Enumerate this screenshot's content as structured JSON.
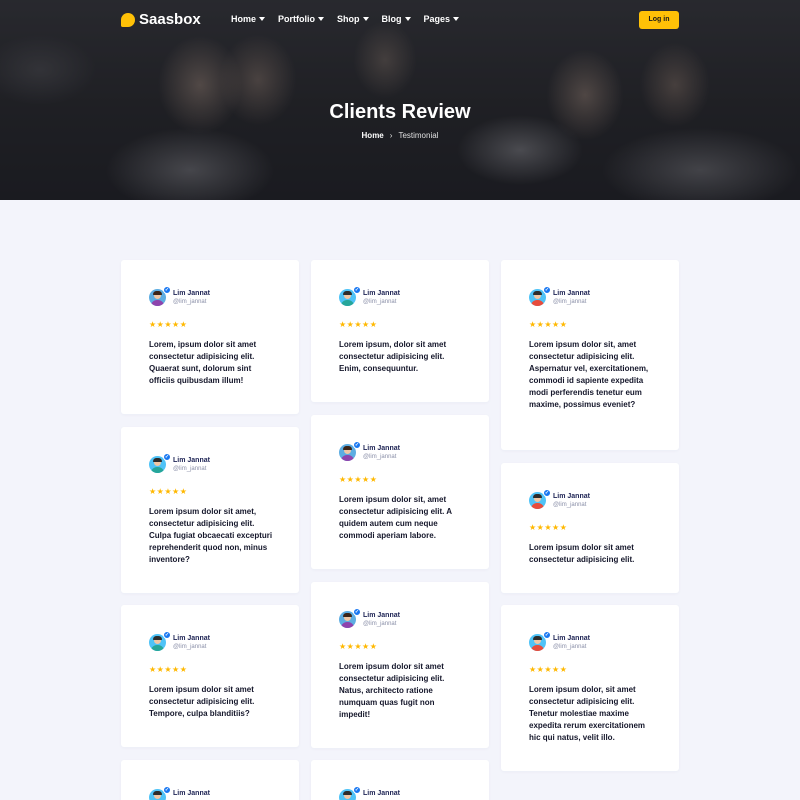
{
  "brand": {
    "name": "Saasbox"
  },
  "nav": {
    "items": [
      {
        "label": "Home"
      },
      {
        "label": "Portfolio"
      },
      {
        "label": "Shop"
      },
      {
        "label": "Blog"
      },
      {
        "label": "Pages"
      }
    ],
    "login_label": "Log in"
  },
  "hero": {
    "title": "Clients Review",
    "breadcrumb": {
      "home": "Home",
      "separator": "›",
      "current": "Testimonial"
    }
  },
  "colors": {
    "accent": "#ffc107",
    "verified": "#1877f2",
    "name_text": "#1d2354",
    "star": "#ffb800",
    "page_bg": "#f3f4fb"
  },
  "reviews": [
    {
      "name": "Lim Jannat",
      "handle": "@lim_jannat",
      "stars": "★★★★★",
      "avatar": "woman-dark-hair",
      "text": "Lorem, ipsum dolor sit amet consectetur adipisicing elit. Quaerat sunt, dolorum sint officiis quibusdam illum!"
    },
    {
      "name": "Lim Jannat",
      "handle": "@lim_jannat",
      "stars": "★★★★★",
      "avatar": "man-teal-shirt",
      "text": "Lorem ipsum, dolor sit amet consectetur adipisicing elit. Enim, consequuntur."
    },
    {
      "name": "Lim Jannat",
      "handle": "@lim_jannat",
      "stars": "★★★★★",
      "avatar": "man-red-shirt",
      "text": "Lorem ipsum dolor sit, amet consectetur adipisicing elit. Aspernatur vel, exercitationem, commodi id sapiente expedita modi perferendis tenetur eum maxime, possimus eveniet?"
    },
    {
      "name": "Lim Jannat",
      "handle": "@lim_jannat",
      "stars": "★★★★★",
      "avatar": "man-teal-shirt",
      "text": "Lorem ipsum dolor sit amet, consectetur adipisicing elit. Culpa fugiat obcaecati excepturi reprehenderit quod non, minus inventore?"
    },
    {
      "name": "Lim Jannat",
      "handle": "@lim_jannat",
      "stars": "★★★★★",
      "avatar": "woman-dark-hair",
      "text": "Lorem ipsum dolor sit, amet consectetur adipisicing elit. A quidem autem cum neque commodi aperiam labore."
    },
    {
      "name": "Lim Jannat",
      "handle": "@lim_jannat",
      "stars": "★★★★★",
      "avatar": "man-red-shirt",
      "text": "Lorem ipsum dolor sit amet consectetur adipisicing elit."
    },
    {
      "name": "Lim Jannat",
      "handle": "@lim_jannat",
      "stars": "★★★★★",
      "avatar": "man-teal-shirt",
      "text": "Lorem ipsum dolor sit amet consectetur adipisicing elit. Tempore, culpa blanditiis?"
    },
    {
      "name": "Lim Jannat",
      "handle": "@lim_jannat",
      "stars": "★★★★★",
      "avatar": "woman-dark-hair",
      "text": "Lorem ipsum dolor sit amet consectetur adipisicing elit. Natus, architecto ratione numquam quas fugit non impedit!"
    },
    {
      "name": "Lim Jannat",
      "handle": "@lim_jannat",
      "stars": "★★★★★",
      "avatar": "man-red-shirt",
      "text": "Lorem ipsum dolor, sit amet consectetur adipisicing elit. Tenetur molestiae maxime expedita rerum exercitationem hic qui natus, velit illo."
    },
    {
      "name": "Lim Jannat",
      "handle": "",
      "stars": "",
      "avatar": "man-teal-shirt",
      "text": ""
    },
    {
      "name": "Lim Jannat",
      "handle": "",
      "stars": "",
      "avatar": "man-teal-shirt",
      "text": ""
    }
  ]
}
